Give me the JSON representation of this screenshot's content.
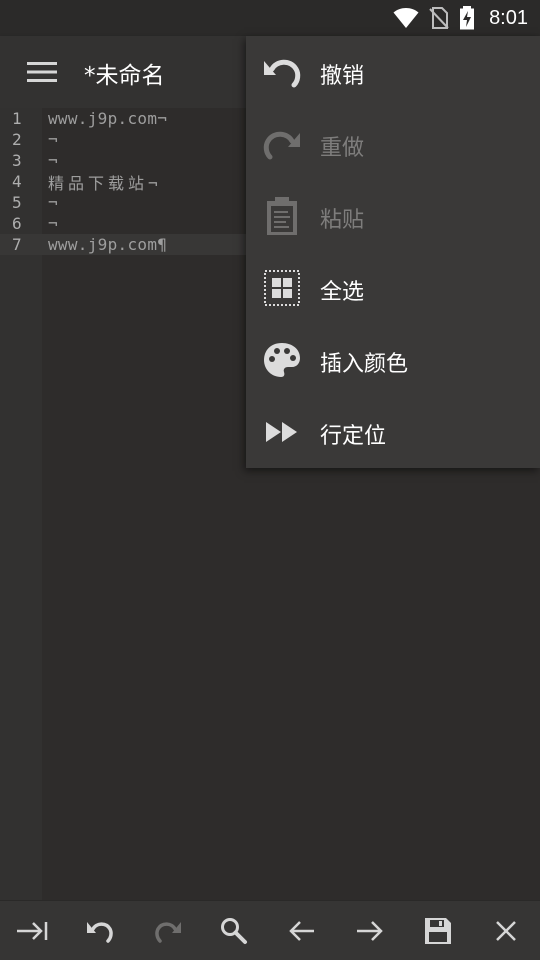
{
  "status_bar": {
    "time": "8:01",
    "icons": [
      "wifi-icon",
      "no-sim-icon",
      "battery-charging-icon"
    ]
  },
  "app_bar": {
    "menu_icon": "hamburger-menu-icon",
    "title": "*未命名"
  },
  "editor": {
    "current_line": 7,
    "lines": [
      {
        "number": "1",
        "text": "www.j9p.com¬"
      },
      {
        "number": "2",
        "text": "¬"
      },
      {
        "number": "3",
        "text": "¬"
      },
      {
        "number": "4",
        "text": "精品下载站¬"
      },
      {
        "number": "5",
        "text": "¬"
      },
      {
        "number": "6",
        "text": "¬"
      },
      {
        "number": "7",
        "text": "www.j9p.com¶"
      }
    ]
  },
  "popup_menu": {
    "items": [
      {
        "label": "撤销",
        "icon": "undo-icon",
        "enabled": true
      },
      {
        "label": "重做",
        "icon": "redo-icon",
        "enabled": false
      },
      {
        "label": "粘贴",
        "icon": "clipboard-icon",
        "enabled": false
      },
      {
        "label": "全选",
        "icon": "select-all-icon",
        "enabled": true
      },
      {
        "label": "插入颜色",
        "icon": "palette-icon",
        "enabled": true
      },
      {
        "label": "行定位",
        "icon": "fast-forward-icon",
        "enabled": true
      }
    ]
  },
  "toolbar": {
    "buttons": [
      {
        "icon": "tab-indent-icon",
        "enabled": true
      },
      {
        "icon": "undo-icon",
        "enabled": true
      },
      {
        "icon": "redo-icon",
        "enabled": false
      },
      {
        "icon": "search-icon",
        "enabled": true
      },
      {
        "icon": "arrow-left-icon",
        "enabled": true
      },
      {
        "icon": "arrow-right-icon",
        "enabled": true
      },
      {
        "icon": "save-icon",
        "enabled": true
      },
      {
        "icon": "close-icon",
        "enabled": true
      }
    ]
  },
  "colors": {
    "background": "#2c2a29",
    "appbar": "#333231",
    "popup": "#3a3938",
    "text_primary": "#ffffff",
    "text_disabled": "#7e7d7c",
    "code_text": "#9e9e9e"
  }
}
